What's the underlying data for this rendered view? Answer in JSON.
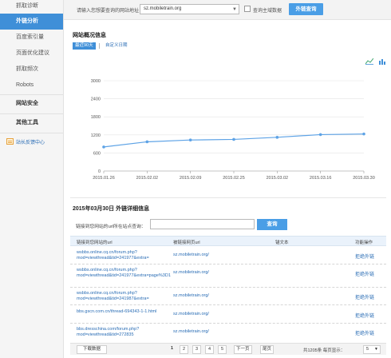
{
  "sidebar": {
    "items": [
      {
        "label": "抓取诊断",
        "active": false,
        "group": false
      },
      {
        "label": "外链分析",
        "active": true,
        "group": false
      },
      {
        "label": "百度索引量",
        "active": false,
        "group": false
      },
      {
        "label": "页面优化建议",
        "active": false,
        "group": false
      },
      {
        "label": "抓取频次",
        "active": false,
        "group": false
      },
      {
        "label": "Robots",
        "active": false,
        "group": false
      },
      {
        "label": "网站安全",
        "active": false,
        "group": true
      },
      {
        "label": "其他工具",
        "active": false,
        "group": true
      }
    ],
    "webmaster_center": "站长反馈中心"
  },
  "query": {
    "prompt": "请输入您想要查询的网站地址：",
    "domain": "sz.mobiletrain.org",
    "main_domain_label": "查询主域数据",
    "submit": "外链查询"
  },
  "overview": {
    "title": "网站概况信息",
    "tab_recent": "最近90天",
    "tab_custom": "自定义日期"
  },
  "chart_data": {
    "type": "line",
    "x": [
      "2015.01.26",
      "2015.02.02",
      "2015.02.09",
      "2015.02.25",
      "2015.03.02",
      "2015.03.16",
      "2015.03.30"
    ],
    "series": [
      {
        "values": [
          800,
          970,
          1030,
          1050,
          1120,
          1210,
          1230
        ]
      }
    ],
    "yticks": [
      "0",
      "600",
      "1200",
      "1800",
      "2400",
      "3000"
    ],
    "ylim": [
      0,
      3000
    ],
    "grid": true,
    "color": "#5ea3e6"
  },
  "details": {
    "title": "2015年03月30日 外链详细信息",
    "search_label": "链接到您网站的url所在站点查询：",
    "search_value": "",
    "search_button": "查询",
    "columns": [
      "链接到您网站的url",
      "被链接网页url",
      "锚文本",
      "功能操作"
    ],
    "rows": [
      {
        "source": "wsbbs.online.cq.cn/forum.php?mod=viewthread&tid=241977&extra=",
        "target": "sz.mobiletrain.org/",
        "anchor": "",
        "action": "拒绝外链"
      },
      {
        "source": "wsbbs.online.cq.cn/forum.php?mod=viewthread&tid=241977&extra=page%3D1",
        "target": "sz.mobiletrain.org/",
        "anchor": "",
        "action": "拒绝外链"
      },
      {
        "source": "wsbbs.online.cq.cn/forum.php?mod=viewthread&tid=241987&extra=",
        "target": "sz.mobiletrain.org/",
        "anchor": "",
        "action": "拒绝外链"
      },
      {
        "source": "bbs.gscn.com.cn/thread-694343-1-1.html",
        "target": "sz.mobiletrain.org/",
        "anchor": "",
        "action": "拒绝外链"
      },
      {
        "source": "bbs.dresschina.com/forum.php?mod=viewthread&tid=272835",
        "target": "sz.mobiletrain.org/",
        "anchor": "",
        "action": "拒绝外链"
      }
    ]
  },
  "pager": {
    "download": "下载数据",
    "pages": [
      "1",
      "2",
      "3",
      "4",
      "5"
    ],
    "next": "下一页",
    "last": "尾页",
    "summary": "共1205条 每页显示：",
    "page_size": "5"
  }
}
